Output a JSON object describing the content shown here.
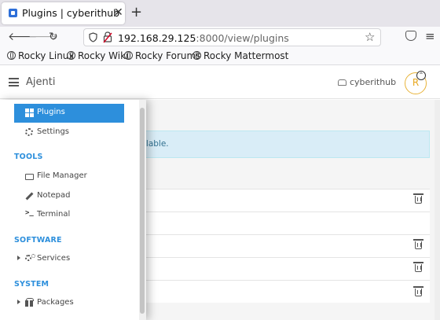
{
  "browser": {
    "tab_title": "Plugins | cyberithub",
    "tab_close": "✕",
    "new_tab": "+",
    "url_host": "192.168.29.125",
    "url_path": ":8000/view/plugins",
    "bookmarks": [
      "Rocky Linux",
      "Rocky Wiki",
      "Rocky Forums",
      "Rocky Mattermost"
    ]
  },
  "header": {
    "app_title": "Ajenti",
    "user_name": "cyberithub",
    "avatar_letter": "R"
  },
  "main": {
    "info_text": "ilable."
  },
  "sidebar": {
    "top_items": [
      {
        "label": "Plugins",
        "icon": "grid-icon",
        "active": true
      },
      {
        "label": "Settings",
        "icon": "gear-icon",
        "active": false
      }
    ],
    "sections": [
      {
        "title": "TOOLS",
        "items": [
          {
            "label": "File Manager",
            "icon": "folder-icon"
          },
          {
            "label": "Notepad",
            "icon": "pencil-icon"
          },
          {
            "label": "Terminal",
            "icon": "terminal-icon"
          }
        ]
      },
      {
        "title": "SOFTWARE",
        "items": [
          {
            "label": "Services",
            "icon": "cogs-icon",
            "expandable": true
          }
        ]
      },
      {
        "title": "SYSTEM",
        "items": [
          {
            "label": "Packages",
            "icon": "gift-icon",
            "expandable": true
          }
        ]
      }
    ]
  },
  "colors": {
    "accent": "#2d8fdc",
    "info_bg": "#d9edf7",
    "info_text": "#31708f",
    "avatar": "#e8b339"
  }
}
